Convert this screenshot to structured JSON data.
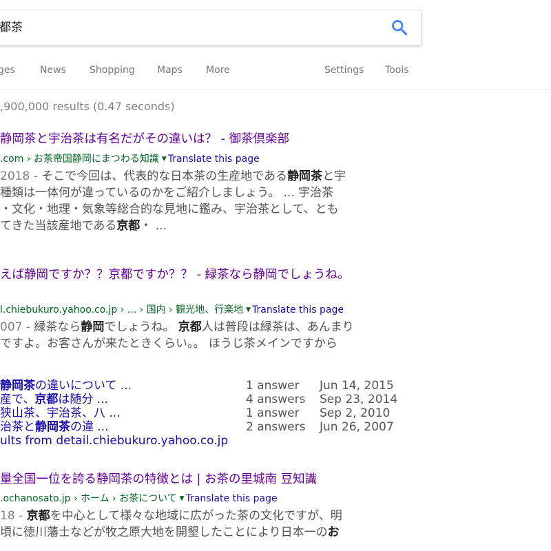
{
  "search": {
    "query": "都茶"
  },
  "tabs": [
    "ges",
    "News",
    "Shopping",
    "Maps",
    "More",
    "Settings",
    "Tools"
  ],
  "stats": ",900,000 results (0.47 seconds)",
  "results": [
    {
      "title": "静岡茶と宇治茶は有名だがその違いは？ - 御茶倶楽部",
      "url": ".com › お茶帝国静岡にまつわる知識",
      "translate": "Translate this page",
      "snippet": [
        "2018 - そこで今回は、代表的な日本茶の生産地である静岡茶と宇",
        "種類は一体何が違っているのかをご紹介しましょう。 ... 宇治茶",
        "・文化・地理・気象等総合的な見地に鑑み、宇治茶として、とも",
        "てきた当該産地である京都・ ..."
      ]
    },
    {
      "title": "えば静岡ですか？？京都ですか？？ - 緑茶なら静岡でしょうね。",
      "url": "l.chiebukuro.yahoo.co.jp › ... › 国内 › 観光地、行楽地",
      "translate": "Translate this page",
      "snippet": [
        "007 - 緑茶なら静岡でしょうね。 京都人は普段は緑茶は、あんまり",
        "ですよ。お客さんが来たときくらい。。 ほうじ茶メインですから"
      ],
      "qa": [
        {
          "link": "静岡茶の違いについて ...",
          "count": "1 answer",
          "date": "Jun 14, 2015"
        },
        {
          "link": "産で、京都は随分 ...",
          "count": "4 answers",
          "date": "Sep 23, 2014"
        },
        {
          "link": "狭山茶、宇治茶、八 ...",
          "count": "1 answer",
          "date": "Sep 2, 2010"
        },
        {
          "link": "治茶と静岡茶の違 ...",
          "count": "2 answers",
          "date": "Jun 26, 2007"
        }
      ],
      "more": "ults from detail.chiebukuro.yahoo.co.jp"
    },
    {
      "title": "量全国一位を誇る静岡茶の特徴とは | お茶の里城南 豆知識",
      "url": ".ochanosato.jp › ホーム › お茶について",
      "translate": "Translate this page",
      "snippet": [
        "18 - 京都を中心として様々な地域に広がった茶の文化ですが、明",
        "頃に徳川藩士などが牧之原大地を開墾したことにより日本一のお"
      ]
    }
  ]
}
